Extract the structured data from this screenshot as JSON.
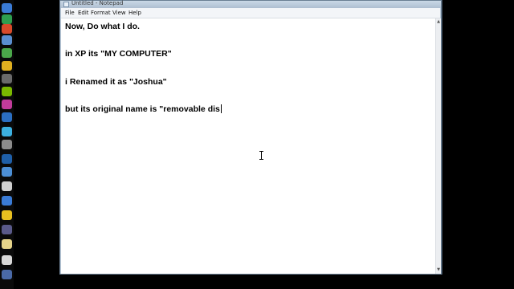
{
  "window": {
    "title": "Untitled - Notepad"
  },
  "menu": {
    "items": [
      "File",
      "Edit",
      "Format",
      "View",
      "Help"
    ]
  },
  "document": {
    "lines": [
      "Now, Do what I do.",
      "in XP its \"MY COMPUTER\"",
      "i Renamed it as \"Joshua\"",
      "but its original name  is \"removable dis"
    ]
  },
  "launcher": {
    "icons": [
      "app-icon",
      "app-icon",
      "app-icon",
      "app-icon",
      "app-icon",
      "app-icon",
      "app-icon",
      "app-icon",
      "app-icon",
      "app-icon",
      "app-icon",
      "app-icon",
      "app-icon",
      "app-icon",
      "app-icon",
      "app-icon",
      "app-icon",
      "app-icon",
      "app-icon",
      "app-icon",
      "app-icon",
      "app-icon",
      "app-icon",
      "app-icon"
    ]
  },
  "colors": {
    "window_frame": "#b9c9d8",
    "menu_bg": "#f3f5f8",
    "text": "#000000"
  }
}
